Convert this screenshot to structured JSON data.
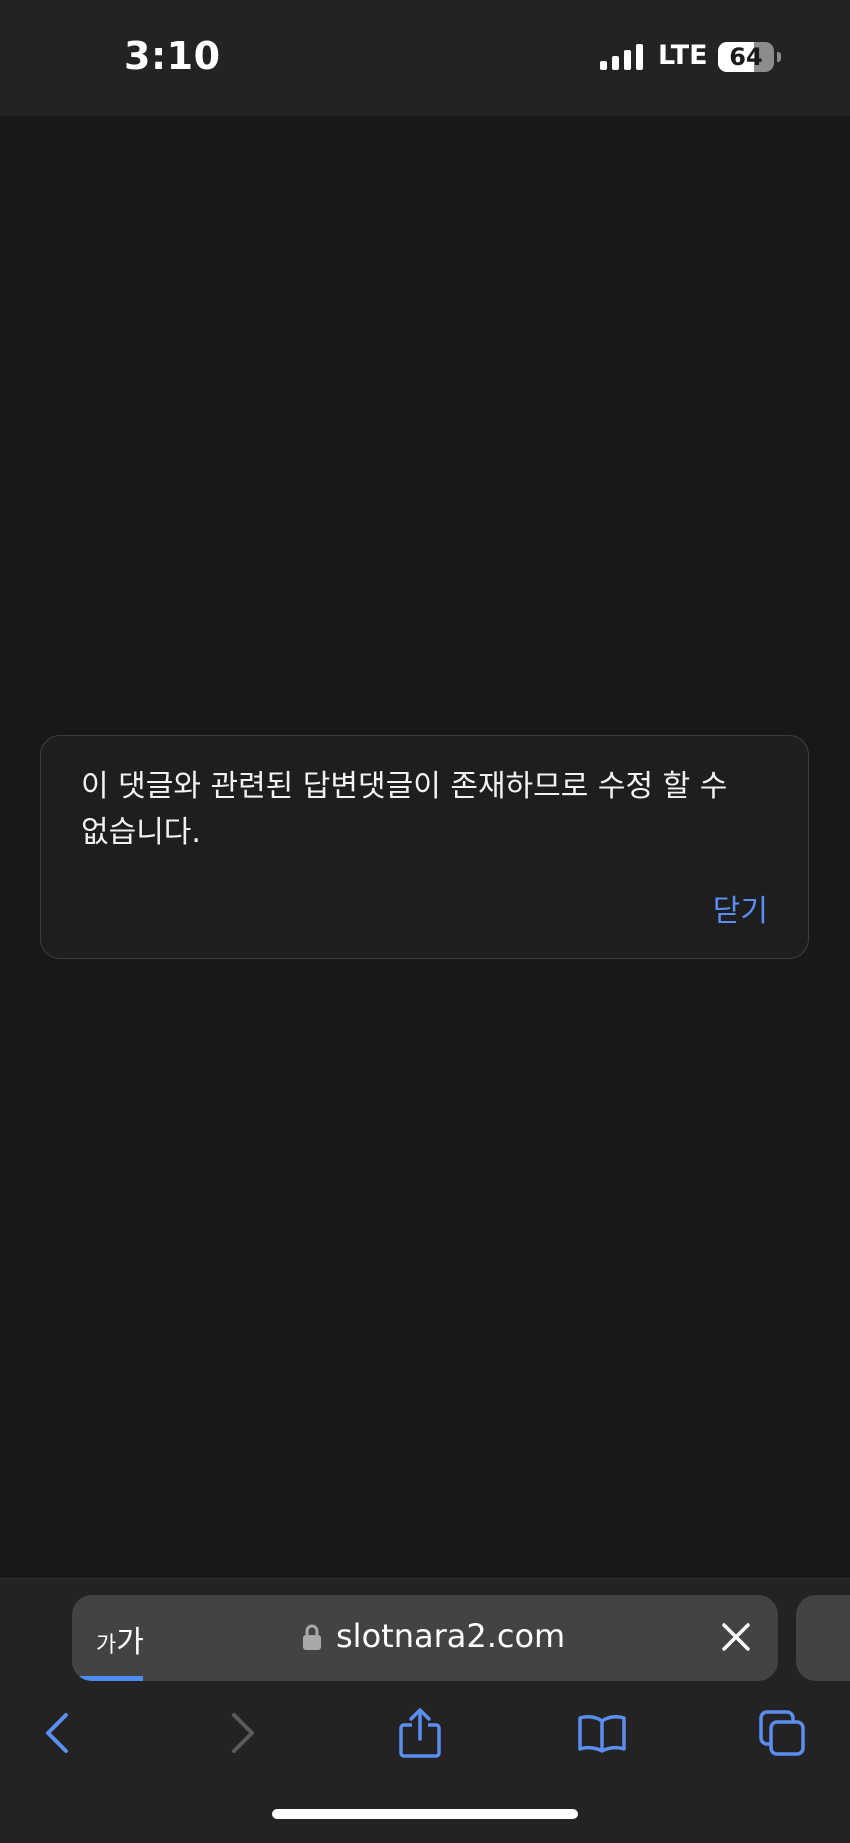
{
  "status_bar": {
    "time": "3:10",
    "network": "LTE",
    "battery_level": "64",
    "battery_fraction": 0.64
  },
  "dialog": {
    "message": "이 댓글와 관련된 답변댓글이 존재하므로 수정 할 수 없습니다.",
    "close_label": "닫기"
  },
  "browser": {
    "text_size_small": "가",
    "text_size_large": "가",
    "url": "slotnara2.com",
    "page_load_progress": 0.1,
    "toolbar": {
      "back_icon": "chevron-left-icon",
      "forward_icon": "chevron-right-icon",
      "share_icon": "share-icon",
      "bookmarks_icon": "book-icon",
      "tabs_icon": "tabs-icon"
    }
  },
  "colors": {
    "accent": "#5a8ef0",
    "background": "#181818",
    "bar_background": "#232323",
    "dialog_background": "#1e1e1f"
  }
}
